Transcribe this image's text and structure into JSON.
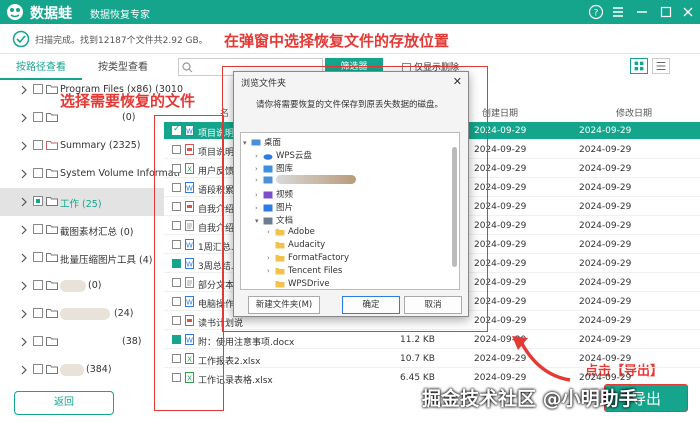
{
  "app": {
    "brand": "数据蛙",
    "subtitle": "数据恢复专家"
  },
  "status": {
    "text": "扫描完成。找到12187个文件共2.92 GB。"
  },
  "annotations": {
    "top": "在弹窗中选择恢复文件的存放位置",
    "left": "选择需要恢复的文件",
    "bottom": "点击【导出】"
  },
  "tabs": [
    {
      "label": "按路径查看",
      "active": true
    },
    {
      "label": "按类型查看",
      "active": false
    }
  ],
  "tree": [
    {
      "label": "Program Files (x86) (3010",
      "checked": false
    },
    {
      "label": "(0)",
      "checked": false
    },
    {
      "label": "Summary (2325)",
      "checked": false
    },
    {
      "label": "System Volume Informati",
      "checked": false
    },
    {
      "label": "工作 (25)",
      "checked": "partial",
      "selected": true
    },
    {
      "label": "截图素材汇总 (0)",
      "checked": false
    },
    {
      "label": "批量压缩图片工具 (4)",
      "checked": false
    },
    {
      "label": "(0)",
      "checked": false
    },
    {
      "label": "(24)",
      "checked": false
    },
    {
      "label": "(38)",
      "checked": false
    },
    {
      "label": "(384)",
      "checked": false
    }
  ],
  "toolbar": {
    "filter_label": "筛选器",
    "only_deleted": "仅显示删除"
  },
  "table": {
    "headers": {
      "name": "名",
      "cdate": "创建日期",
      "mdate": "修改日期"
    },
    "rows": [
      {
        "name": "项目说明书",
        "size": "",
        "cdate": "2024-09-29",
        "mdate": "2024-09-29",
        "checked": true,
        "selected": true,
        "icon": "word"
      },
      {
        "name": "项目说明书",
        "size": "",
        "cdate": "2024-09-29",
        "mdate": "2024-09-29",
        "checked": false,
        "icon": "ppt"
      },
      {
        "name": "用户反馈数",
        "size": "",
        "cdate": "2024-09-29",
        "mdate": "2024-09-29",
        "checked": false,
        "icon": "excel"
      },
      {
        "name": "语段积累.d",
        "size": "",
        "cdate": "2024-09-29",
        "mdate": "2024-09-29",
        "checked": false,
        "icon": "word"
      },
      {
        "name": "自我介绍.p",
        "size": "",
        "cdate": "2024-09-29",
        "mdate": "2024-09-29",
        "checked": false,
        "icon": "ppt"
      },
      {
        "name": "自我介绍.tx",
        "size": "",
        "cdate": "2024-09-29",
        "mdate": "2024-09-29",
        "checked": false,
        "icon": "txt"
      },
      {
        "name": "1周汇总.do",
        "size": "",
        "cdate": "2024-09-29",
        "mdate": "2024-09-29",
        "checked": false,
        "icon": "word"
      },
      {
        "name": "3周总结.do",
        "size": "",
        "cdate": "2024-09-29",
        "mdate": "2024-09-29",
        "checked": true,
        "icon": "word"
      },
      {
        "name": "部分文本模",
        "size": "",
        "cdate": "2024-09-29",
        "mdate": "2024-09-29",
        "checked": false,
        "icon": "txt"
      },
      {
        "name": "电脑操作指",
        "size": "",
        "cdate": "2024-09-29",
        "mdate": "2024-09-29",
        "checked": false,
        "icon": "word"
      },
      {
        "name": "读书计划说",
        "size": "",
        "cdate": "2024-09-29",
        "mdate": "2024-09-29",
        "checked": false,
        "icon": "ppt"
      },
      {
        "name": "附：使用注意事项.docx",
        "size": "11.2 KB",
        "cdate": "2024-09-29",
        "mdate": "2024-09-29",
        "checked": true,
        "icon": "word"
      },
      {
        "name": "工作报表2.xlsx",
        "size": "10.7 KB",
        "cdate": "2024-09-29",
        "mdate": "2024-09-29",
        "checked": false,
        "icon": "excel"
      },
      {
        "name": "工作记录表格.xlsx",
        "size": "6.45 KB",
        "cdate": "2024-09-29",
        "mdate": "2024-09-29",
        "checked": false,
        "icon": "excel"
      }
    ]
  },
  "dialog": {
    "title": "浏览文件夹",
    "message": "请你将需要恢复的文件保存到原丢失数据的磁盘。",
    "nodes": [
      {
        "label": "桌面",
        "level": 0,
        "expanded": true,
        "icon": "desktop"
      },
      {
        "label": "WPS云盘",
        "level": 1,
        "expanded": false,
        "icon": "cloud"
      },
      {
        "label": "图库",
        "level": 1,
        "expanded": false,
        "icon": "gallery"
      },
      {
        "label": "",
        "level": 1,
        "expanded": false,
        "icon": "folder-blue"
      },
      {
        "label": "视频",
        "level": 1,
        "expanded": false,
        "icon": "video"
      },
      {
        "label": "图片",
        "level": 1,
        "expanded": false,
        "icon": "picture"
      },
      {
        "label": "文档",
        "level": 1,
        "expanded": true,
        "icon": "document"
      },
      {
        "label": "Adobe",
        "level": 2,
        "expanded": false,
        "icon": "folder"
      },
      {
        "label": "Audacity",
        "level": 2,
        "expanded": false,
        "icon": "folder"
      },
      {
        "label": "FormatFactory",
        "level": 2,
        "expanded": false,
        "icon": "folder"
      },
      {
        "label": "Tencent Files",
        "level": 2,
        "expanded": false,
        "icon": "folder"
      },
      {
        "label": "WPSDrive",
        "level": 2,
        "expanded": false,
        "icon": "folder"
      }
    ],
    "new_folder": "新建文件夹(M)",
    "ok": "确定",
    "cancel": "取消"
  },
  "back_label": "返回",
  "export_label": "导出",
  "watermark": "掘金技术社区 @小明助手",
  "colors": {
    "brand": "#14a58c",
    "annotation": "#e53935",
    "dialog_primary": "#2d7be5"
  }
}
